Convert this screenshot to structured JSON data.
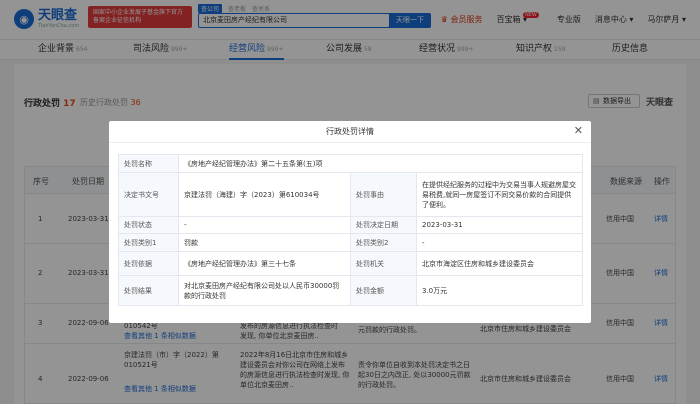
{
  "app": {
    "logo_text": "天眼查",
    "logo_sub": "TianYanCha.com",
    "promo_text": "国家中小企业发展子基金旗下官方备案企业征信机构"
  },
  "search": {
    "tabs": [
      "查公司",
      "查老板",
      "查关系"
    ],
    "value": "北京麦田房产经纪有限公司",
    "button": "天眼一下"
  },
  "top_links": {
    "vip": "会员服务",
    "baibao": "百宝箱",
    "baibao_badge": "NEW",
    "pro": "专业版",
    "msg": "消息中心",
    "user": "马尔萨月"
  },
  "nav": [
    {
      "label": "企业背景",
      "count": "654"
    },
    {
      "label": "司法风险",
      "count": "999+"
    },
    {
      "label": "经营风险",
      "count": "999+"
    },
    {
      "label": "公司发展",
      "count": "58"
    },
    {
      "label": "经营状况",
      "count": "999+"
    },
    {
      "label": "知识产权",
      "count": "159"
    },
    {
      "label": "历史信息",
      "count": ""
    }
  ],
  "section": {
    "title": "行政处罚",
    "count": "17",
    "history_label": "历史行政处罚",
    "history_count": "36",
    "download": "数据导出",
    "watermark": "天眼查"
  },
  "bg_table": {
    "headers": [
      "序号",
      "处罚日期",
      "",
      "",
      "",
      "数据来源",
      "操作"
    ],
    "rows": [
      {
        "no": "1",
        "date": "2023-03-31",
        "source": "信用中国",
        "action": "详情"
      },
      {
        "no": "2",
        "date": "2023-03-31",
        "source": "信用中国",
        "action": "详情"
      },
      {
        "no": "3",
        "date": "2022-09-06",
        "source": "信用中国",
        "action": "详情",
        "docno": "010542号",
        "more": "查看其他 1 条相似数据",
        "reason": "发布的房源信息进行执法检查时",
        "reason2": "发现, 你单位北京麦田房..",
        "result": "元罚款的行政处罚。",
        "org": "北京市住房和城乡建设委员会"
      },
      {
        "no": "4",
        "date": "2022-09-06",
        "source": "信用中国",
        "action": "详情",
        "docno": "京建法罚（市）字（2022）第 010521号",
        "more": "查看其他 1 条相似数据",
        "reason": "2022年8月16日北京市住房和城乡建设委员会对你公司在网络上发布的房源信息进行执法检查时发现, 你单位北京麦田房..",
        "result": "责令你单位自收到本处罚决定书之日起30日之内改正, 处以30000元罚款的行政处罚。",
        "org": "北京市住房和城乡建设委员会"
      }
    ]
  },
  "modal": {
    "title": "行政处罚详情",
    "rows": [
      {
        "l1": "处罚名称",
        "v1": "《房地产经纪管理办法》第二十五条第(五)项"
      },
      {
        "l1": "决定书文号",
        "v1": "京建法罚（海建）字（2023）第610034号",
        "l2": "处罚事由",
        "v2": "在提供经纪服务的过程中为交易当事人规避房屋交易税费,就同一房屋签订不同交易价款的合同提供了便利。"
      },
      {
        "l1": "处罚状态",
        "v1": "-",
        "l2": "处罚决定日期",
        "v2": "2023-03-31"
      },
      {
        "l1": "处罚类别1",
        "v1": "罚款",
        "l2": "处罚类别2",
        "v2": "-"
      },
      {
        "l1": "处罚依据",
        "v1": "《房地产经纪管理办法》第三十七条",
        "l2": "处罚机关",
        "v2": "北京市海淀区住房和城乡建设委员会"
      },
      {
        "l1": "处罚结果",
        "v1": "对北京麦田房产经纪有限公司处以人民币30000罚款的行政处罚",
        "l2": "处罚金额",
        "v2": "3.0万元"
      }
    ]
  }
}
